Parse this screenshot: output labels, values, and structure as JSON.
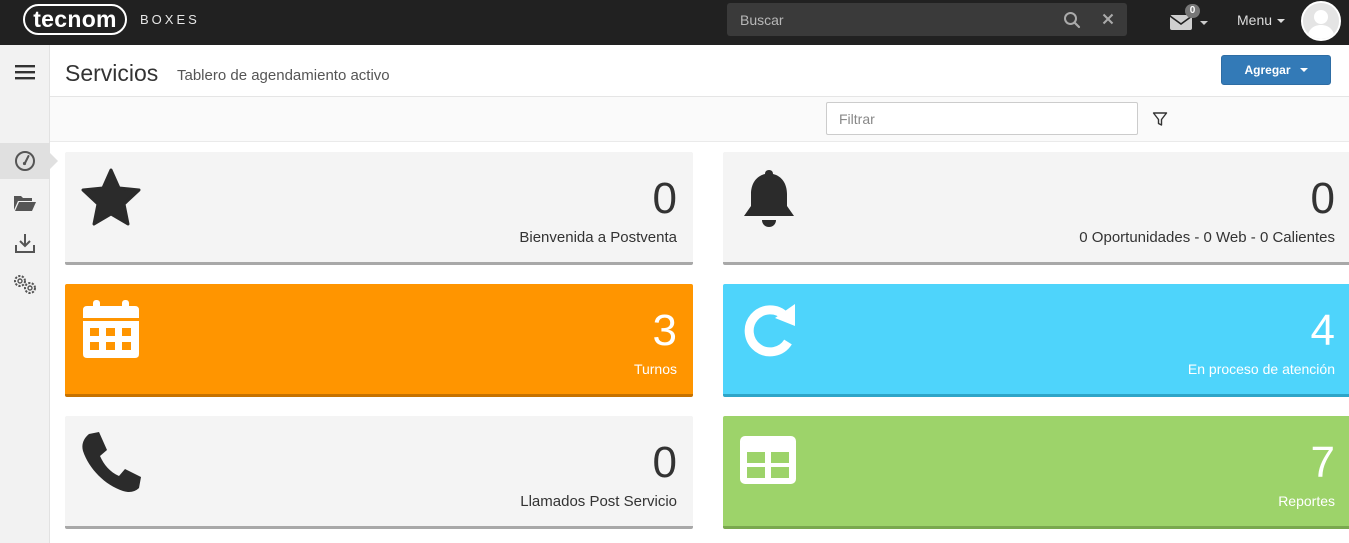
{
  "brand": {
    "logo_text": "tecnom",
    "product": "BOXES"
  },
  "search": {
    "placeholder": "Buscar"
  },
  "notifications": {
    "count": "0"
  },
  "user_menu": {
    "label": "Menu"
  },
  "page": {
    "title": "Servicios",
    "subtitle": "Tablero de agendamiento activo",
    "add_label": "Agregar"
  },
  "filter": {
    "placeholder": "Filtrar"
  },
  "sidebar": {
    "items": [
      {
        "icon": "hamburger-menu-icon"
      },
      {
        "icon": "dashboard-gauge-icon",
        "active": true
      },
      {
        "icon": "folder-open-icon"
      },
      {
        "icon": "download-tray-icon"
      },
      {
        "icon": "gears-icon"
      }
    ]
  },
  "cards": [
    {
      "count": "0",
      "label": "Bienvenida a Postventa",
      "icon": "star-icon",
      "color": "#f4f4f4"
    },
    {
      "count": "0",
      "label": "0 Oportunidades - 0 Web - 0 Calientes",
      "icon": "bell-icon",
      "color": "#f4f4f4"
    },
    {
      "count": "3",
      "label": "Turnos",
      "icon": "calendar-icon",
      "color": "#ff9500"
    },
    {
      "count": "4",
      "label": "En proceso de atención",
      "icon": "refresh-icon",
      "color": "#4ed4fb"
    },
    {
      "count": "0",
      "label": "Llamados Post Servicio",
      "icon": "phone-icon",
      "color": "#f4f4f4"
    },
    {
      "count": "7",
      "label": "Reportes",
      "icon": "table-icon",
      "color": "#9dd36a"
    }
  ],
  "theme": {
    "navbar": "#212121",
    "primary": "#337ab7"
  }
}
